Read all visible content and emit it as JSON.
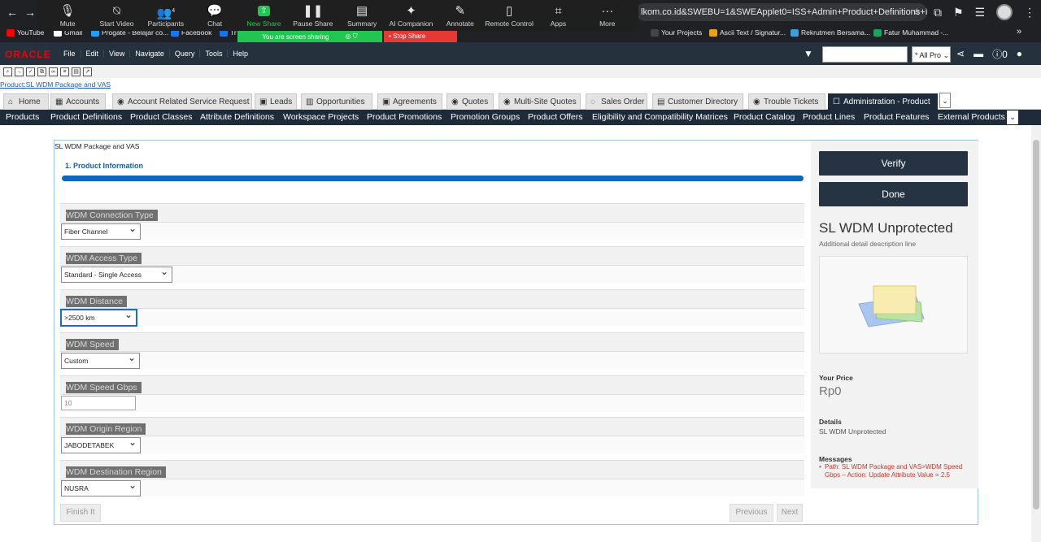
{
  "browser": {
    "url": "lkom.co.id&SWEBU=1&SWEApplet0=ISS+Admin+Product+Definitions+List+...",
    "bookmarks": [
      "YouTube",
      "Gmail",
      "Progate - Belajar co...",
      "Facebook",
      "Tr",
      "Your Projects",
      "Ascii Text / Signatur...",
      "Rekrutmen Bersama...",
      "Fatur Muhammad -..."
    ]
  },
  "zoom": {
    "controls": [
      {
        "icon": "mic-icon",
        "glyph": "🎙",
        "label": "Mute"
      },
      {
        "icon": "video-off-icon",
        "glyph": "▭",
        "label": "Start Video"
      },
      {
        "icon": "participants-icon",
        "glyph": "👥",
        "label": "Participants",
        "count": "4"
      },
      {
        "icon": "chat-icon",
        "glyph": "💬",
        "label": "Chat"
      },
      {
        "icon": "new-share-icon",
        "glyph": "⇧",
        "label": "New Share"
      },
      {
        "icon": "pause-icon",
        "glyph": "❚❚",
        "label": "Pause Share"
      },
      {
        "icon": "summary-icon",
        "glyph": "📄",
        "label": "Summary"
      },
      {
        "icon": "ai-icon",
        "glyph": "✦",
        "label": "AI Companion"
      },
      {
        "icon": "annotate-icon",
        "glyph": "✎",
        "label": "Annotate"
      },
      {
        "icon": "remote-icon",
        "glyph": "🖱",
        "label": "Remote Control"
      },
      {
        "icon": "apps-icon",
        "glyph": "⌗",
        "label": "Apps"
      },
      {
        "icon": "more-icon",
        "glyph": "···",
        "label": "More"
      }
    ],
    "sharing_text": "You are screen sharing",
    "stop_share": "Stop Share"
  },
  "header": {
    "logo": "ORACLE",
    "menu": [
      "File",
      "Edit",
      "View",
      "Navigate",
      "Query",
      "Tools",
      "Help"
    ],
    "search_scope": "* All Pro"
  },
  "breadcrumb": "Product:SL WDM Package and VAS",
  "tabs": [
    "Home",
    "Accounts",
    "Account Related Service Request",
    "Leads",
    "Opportunities",
    "Agreements",
    "Quotes",
    "Multi-Site Quotes",
    "Sales Order",
    "Customer Directory",
    "Trouble Tickets",
    "Administration - Product"
  ],
  "subnav": [
    "Products",
    "Product Definitions",
    "Product Classes",
    "Attribute Definitions",
    "Workspace Projects",
    "Product Promotions",
    "Promotion Groups",
    "Product Offers",
    "Eligibility and Compatibility Matrices",
    "Product Catalog",
    "Product Lines",
    "Product Features",
    "External Products"
  ],
  "configurator": {
    "title": "SL WDM Package and VAS",
    "step": "1. Product Information",
    "attributes": [
      {
        "label": "WDM Connection Type",
        "value": "Fiber Channel",
        "type": "select"
      },
      {
        "label": "WDM Access Type",
        "value": "Standard - Single Access",
        "type": "select"
      },
      {
        "label": "WDM Distance",
        "value": ">2500 km",
        "type": "select",
        "focused": true
      },
      {
        "label": "WDM Speed",
        "value": "Custom",
        "type": "select"
      },
      {
        "label": "WDM Speed Gbps",
        "value": "10",
        "type": "text"
      },
      {
        "label": "WDM Origin Region",
        "value": "JABODETABEK",
        "type": "select"
      },
      {
        "label": "WDM Destination Region",
        "value": "NUSRA",
        "type": "select"
      }
    ],
    "buttons": {
      "finish": "Finish It",
      "previous": "Previous",
      "next": "Next"
    }
  },
  "side_panel": {
    "verify": "Verify",
    "done": "Done",
    "product_name": "SL WDM Unprotected",
    "description": "Additional detail description line",
    "your_price_label": "Your Price",
    "price": "Rp0",
    "details_label": "Details",
    "details_value": "SL WDM Unprotected",
    "messages_label": "Messages",
    "message": "Path: SL WDM Package and VAS>WDM Speed Gbps – Action: Update Attribute Value = 2.5"
  },
  "colors": {
    "oracle_header": "#25313d",
    "subnav": "#1d2b3a",
    "progress": "#0a6ab8",
    "message": "#c0392b",
    "zoom_green": "#23c552"
  }
}
